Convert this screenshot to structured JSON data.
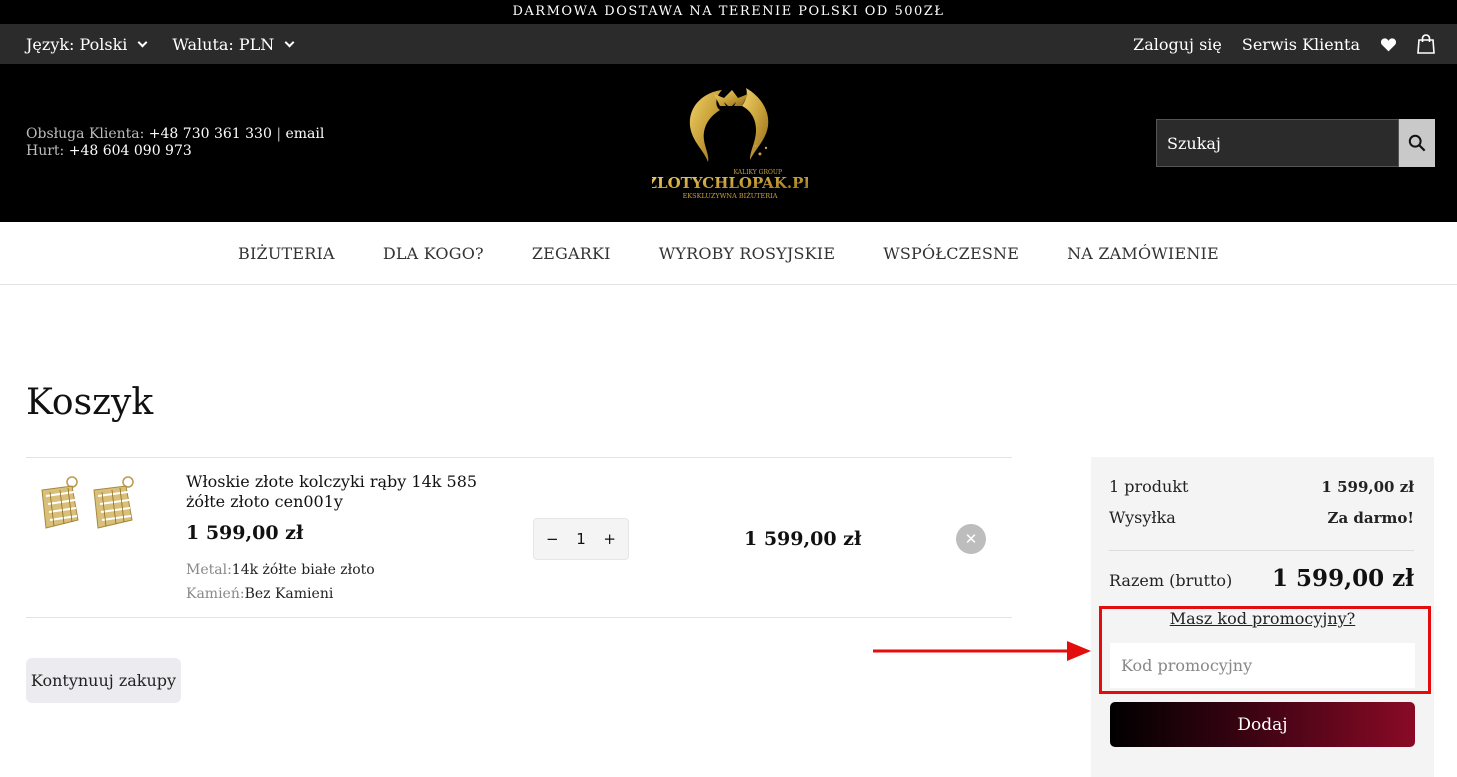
{
  "promo_bar": {
    "text": "DARMOWA DOSTAWA NA TERENIE POLSKI OD 500ZŁ"
  },
  "top_bar": {
    "language": "Język: Polski",
    "currency": "Waluta: PLN",
    "login": "Zaloguj się",
    "service": "Serwis Klienta",
    "icons": [
      "heart-icon",
      "shopping-bag-icon"
    ]
  },
  "header": {
    "contact_label": "Obsługa Klienta:",
    "contact_phone": "+48 730 361 330",
    "separator": "|",
    "email": "email",
    "wholesale_label": "Hurt:",
    "wholesale_phone": "+48 604 090 973",
    "logo": {
      "brand": "ZLOTYCHLOPAK.PL",
      "group": "KALIKY GROUP",
      "tagline": "EKSKLUZYWNA BIŻUTERIA"
    },
    "search_placeholder": "Szukaj"
  },
  "nav": [
    "BIŻUTERIA",
    "DLA KOGO?",
    "ZEGARKI",
    "WYROBY ROSYJSKIE",
    "WSPÓŁCZESNE",
    "NA ZAMÓWIENIE"
  ],
  "cart": {
    "title": "Koszyk",
    "item": {
      "name": "Włoskie złote kolczyki rąby 14k 585 żółte złoto cen001y",
      "price": "1 599,00 zł",
      "metal_label": "Metal:",
      "metal_value": "14k żółte białe złoto",
      "stone_label": "Kamień:",
      "stone_value": "Bez Kamieni",
      "quantity": "1",
      "minus": "−",
      "plus": "+",
      "line_total": "1 599,00 zł",
      "remove": "✕"
    },
    "continue_label": "Kontynuuj zakupy"
  },
  "summary": {
    "products_label": "1 produkt",
    "products_value": "1 599,00 zł",
    "shipping_label": "Wysyłka",
    "shipping_value": "Za darmo!",
    "total_label": "Razem (brutto)",
    "total_value": "1 599,00 zł",
    "promo_question": "Masz kod promocyjny?",
    "promo_placeholder": "Kod promocyjny",
    "add_label": "Dodaj"
  },
  "colors": {
    "accent_red": "#e40d0d",
    "gold": "#c9a23a",
    "button_gradient_end": "#8a0a26"
  }
}
